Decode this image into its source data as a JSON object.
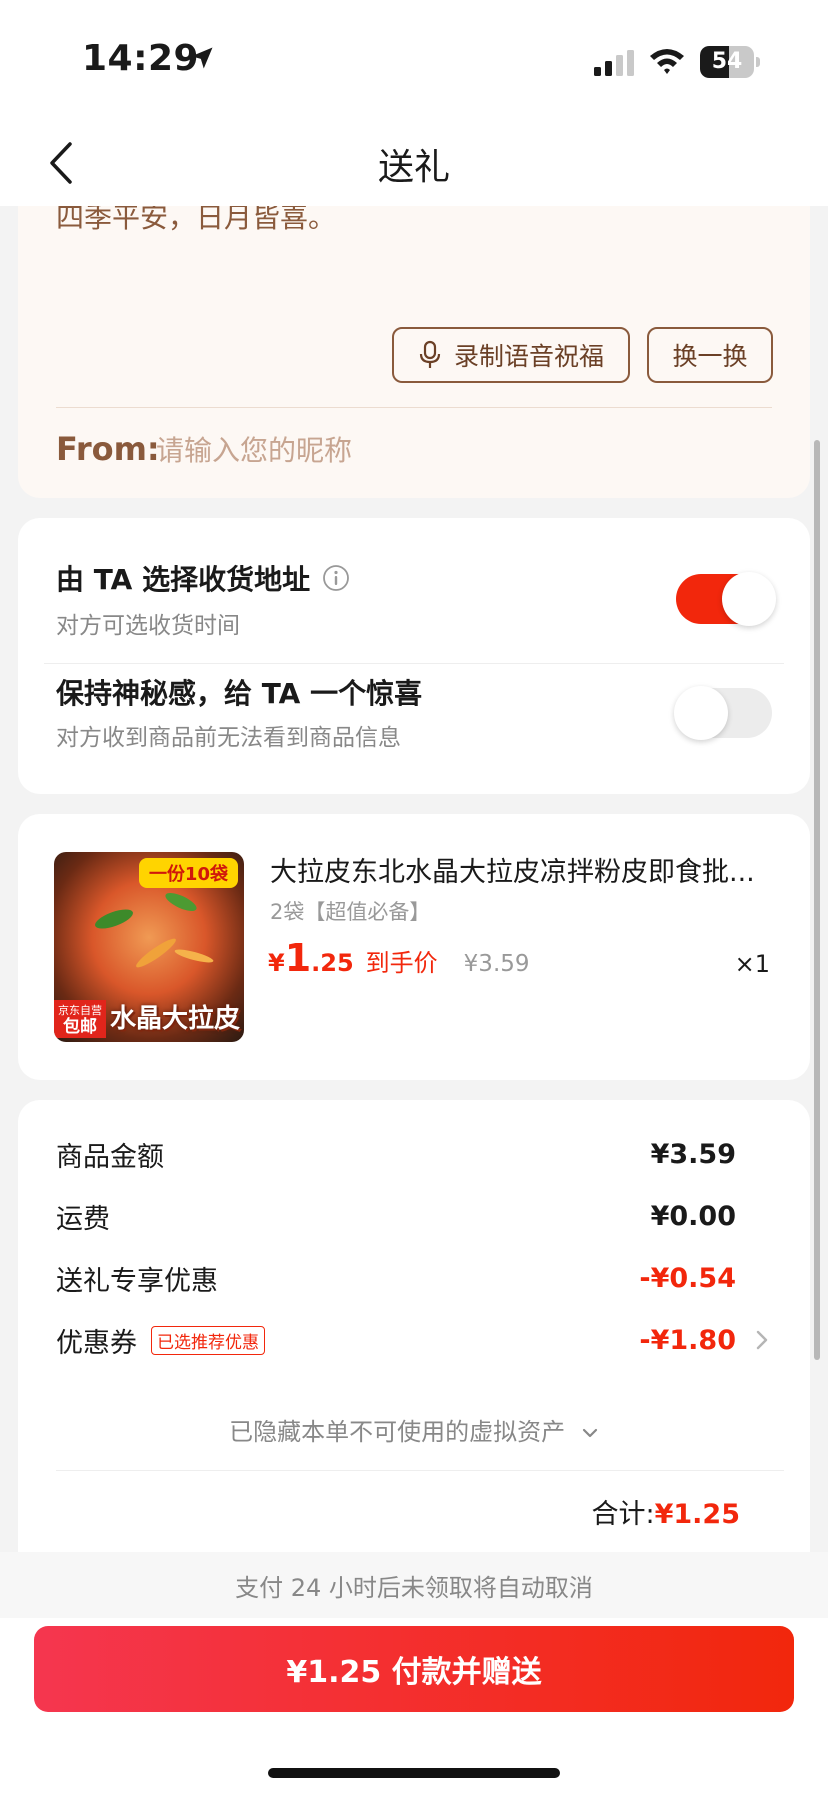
{
  "status_bar": {
    "time": "14:29",
    "battery": "54",
    "battery_level": 0.54,
    "icons": [
      "location-arrow-icon",
      "cellular-signal-icon",
      "wifi-icon",
      "battery-icon"
    ]
  },
  "nav": {
    "title": "送礼"
  },
  "message_card": {
    "text": "四季平安，日月皆喜。",
    "record_label": "录制语音祝福",
    "swap_label": "换一换",
    "from_label": "From:",
    "from_placeholder": "请输入您的昵称",
    "from_value": ""
  },
  "options": [
    {
      "title": "由 TA 选择收货地址",
      "subtitle": "对方可选收货时间",
      "enabled": true
    },
    {
      "title": "保持神秘感，给 TA 一个惊喜",
      "subtitle": "对方收到商品前无法看到商品信息",
      "enabled": false
    }
  ],
  "product": {
    "title": "大拉皮东北水晶大拉皮凉拌粉皮即食批...",
    "spec": "2袋【超值必备】",
    "price_currency": "¥",
    "price_int": "1",
    "price_dec": ".25",
    "price_tag": "到手价",
    "original_price": "¥3.59",
    "quantity": "×1",
    "image": {
      "badge": "一份10袋",
      "tag_line1": "京东自营",
      "tag_line2": "包邮",
      "caption": "水晶大拉皮"
    }
  },
  "summary": {
    "rows": [
      {
        "label": "商品金额",
        "value": "¥3.59",
        "color": "#1a1a1a"
      },
      {
        "label": "运费",
        "value": "¥0.00",
        "color": "#1a1a1a"
      },
      {
        "label": "送礼专享优惠",
        "value": "-¥0.54",
        "color": "#f2270c"
      },
      {
        "label": "优惠券",
        "badge": "已选推荐优惠",
        "value": "-¥1.80",
        "color": "#f2270c"
      }
    ],
    "hidden_assets": "已隐藏本单不可使用的虚拟资产",
    "total_label": "合计:",
    "total_value": "¥1.25"
  },
  "footer": {
    "hint": "支付 24 小时后未领取将自动取消",
    "pay_label": "¥1.25 付款并赠送"
  },
  "colors": {
    "accent": "#f2270c",
    "message_brown": "#8a5a3c",
    "message_bg": "#fdf8f4"
  }
}
